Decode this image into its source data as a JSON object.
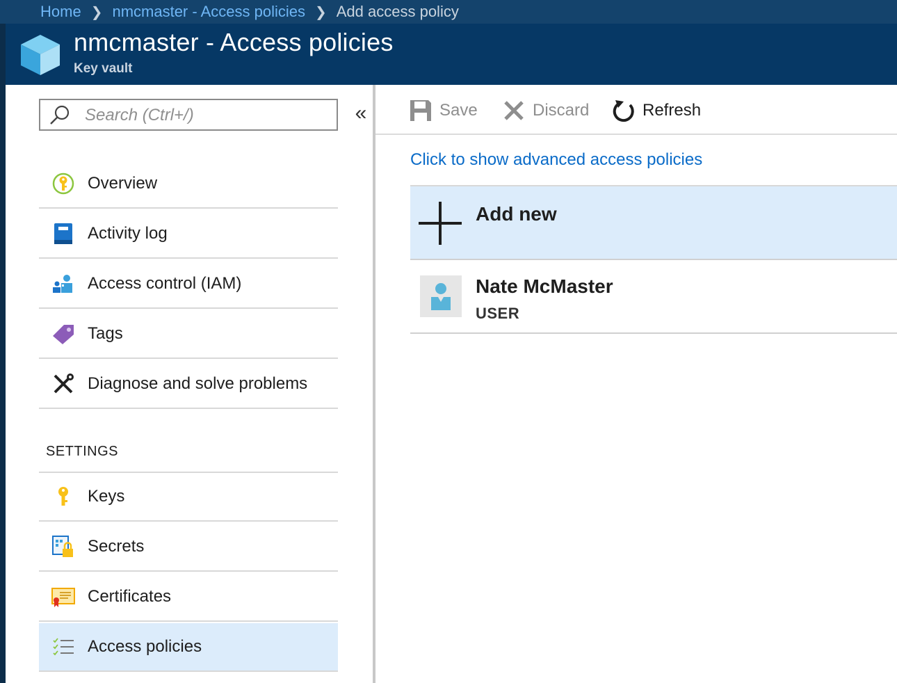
{
  "breadcrumb": {
    "items": [
      "Home",
      "nmcmaster - Access policies"
    ],
    "current": "Add access policy"
  },
  "header": {
    "title": "nmcmaster - Access policies",
    "subtitle": "Key vault",
    "icon": "key-vault-cube-icon"
  },
  "sidebar": {
    "search": {
      "placeholder": "Search (Ctrl+/)",
      "value": ""
    },
    "collapse_label": "«",
    "items": [
      {
        "label": "Overview",
        "icon": "overview-key-icon"
      },
      {
        "label": "Activity log",
        "icon": "activity-log-book-icon"
      },
      {
        "label": "Access control (IAM)",
        "icon": "iam-people-icon"
      },
      {
        "label": "Tags",
        "icon": "tag-icon"
      },
      {
        "label": "Diagnose and solve problems",
        "icon": "wrench-screwdriver-icon"
      }
    ],
    "settings_header": "SETTINGS",
    "settings_items": [
      {
        "label": "Keys",
        "icon": "key-icon"
      },
      {
        "label": "Secrets",
        "icon": "secret-lock-icon"
      },
      {
        "label": "Certificates",
        "icon": "certificate-icon"
      },
      {
        "label": "Access policies",
        "icon": "checklist-icon",
        "active": true
      }
    ]
  },
  "toolbar": {
    "save_label": "Save",
    "discard_label": "Discard",
    "refresh_label": "Refresh"
  },
  "main": {
    "advanced_link": "Click to show advanced access policies",
    "add_new_label": "Add new",
    "policies": [
      {
        "name": "Nate McMaster",
        "type": "USER"
      }
    ]
  },
  "colors": {
    "breadcrumb_bg": "#14436c",
    "header_bg": "#063865",
    "link": "#0a6bc8",
    "active_bg": "#dcecfb"
  }
}
